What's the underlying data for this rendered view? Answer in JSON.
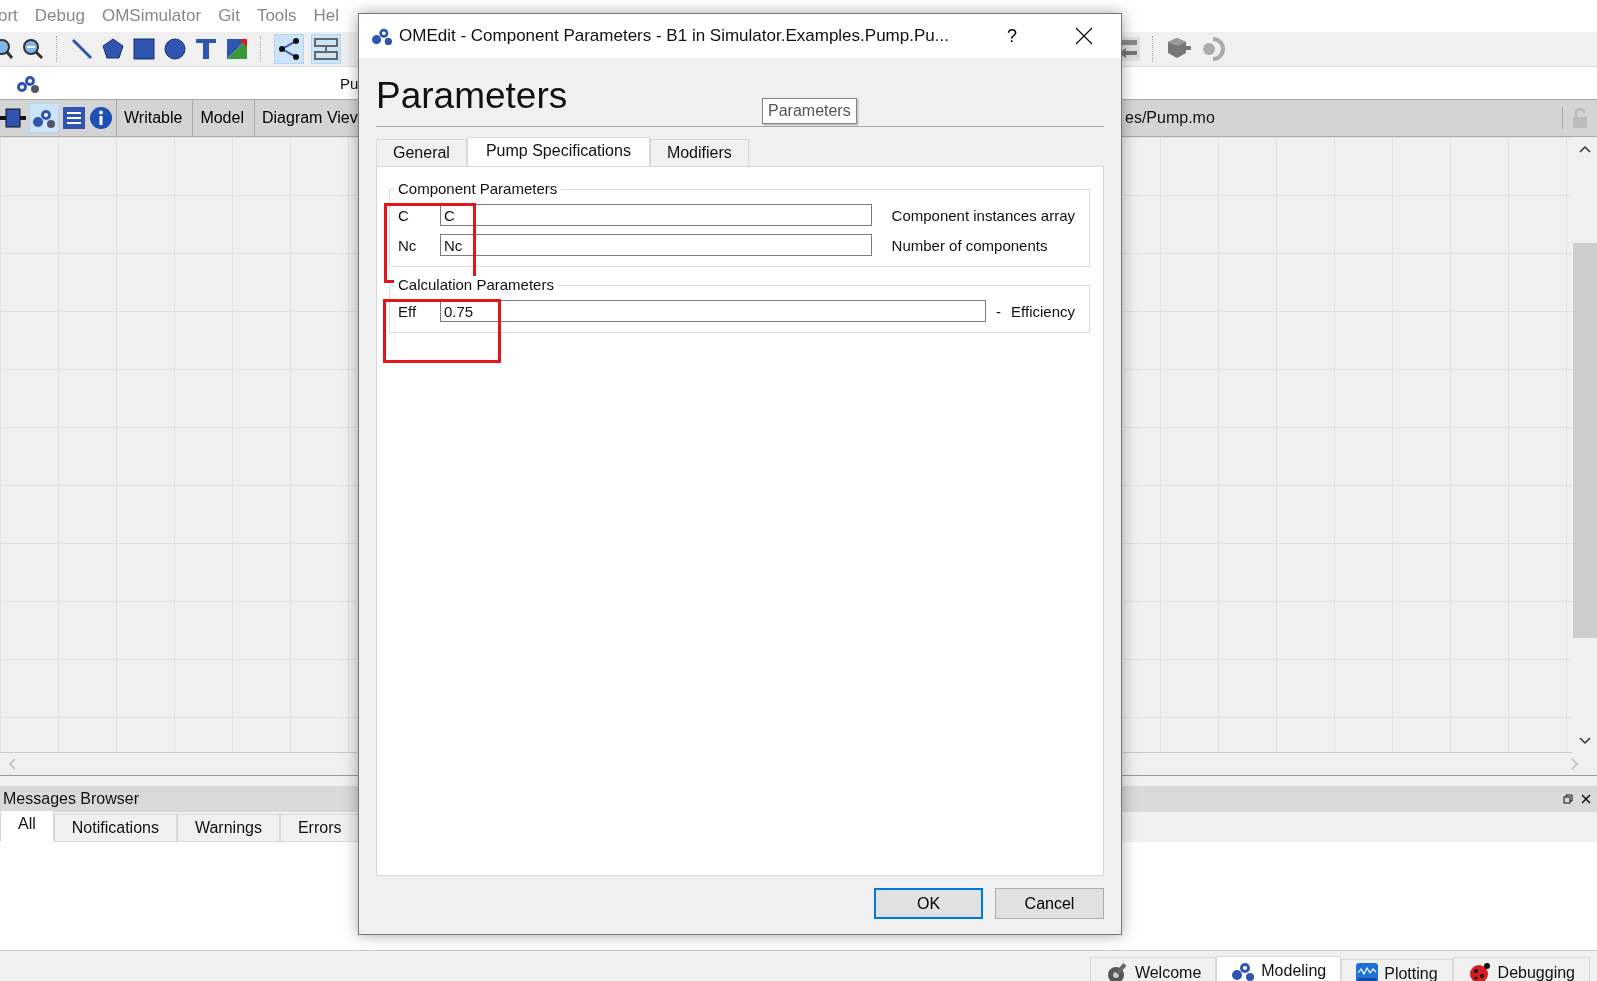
{
  "menu_bar": {
    "items": [
      "ort",
      "Debug",
      "OMSimulator",
      "Git",
      "Tools",
      "Hel"
    ]
  },
  "model_header": {
    "label": "Pu"
  },
  "model_bar": {
    "buttons": [
      "Writable",
      "Model",
      "Diagram Viev"
    ],
    "path": "es/Pump.mo"
  },
  "messages_browser": {
    "title": "Messages Browser",
    "tabs": [
      {
        "label": "All",
        "selected": true
      },
      {
        "label": "Notifications",
        "selected": false
      },
      {
        "label": "Warnings",
        "selected": false
      },
      {
        "label": "Errors",
        "selected": false
      }
    ]
  },
  "perspectives": [
    {
      "label": "Welcome",
      "selected": false
    },
    {
      "label": "Modeling",
      "selected": true
    },
    {
      "label": "Plotting",
      "selected": false
    },
    {
      "label": "Debugging",
      "selected": false
    }
  ],
  "dialog": {
    "title": "OMEdit - Component Parameters - B1 in Simulator.Examples.Pump.Pu...",
    "help": "?",
    "heading": "Parameters",
    "tooltip": "Parameters",
    "tabs": [
      {
        "label": "General",
        "selected": false
      },
      {
        "label": "Pump Specifications",
        "selected": true
      },
      {
        "label": "Modifiers",
        "selected": false
      }
    ],
    "groups": [
      {
        "title": "Component Parameters",
        "highlighted": true,
        "params": [
          {
            "name": "C",
            "value": "C",
            "description": "Component instances array"
          },
          {
            "name": "Nc",
            "value": "Nc",
            "description": "Number of components"
          }
        ]
      },
      {
        "title": "Calculation Parameters",
        "highlighted": true,
        "params": [
          {
            "name": "Eff",
            "value": "0.75",
            "unit": "-",
            "description": "Efficiency"
          }
        ]
      }
    ],
    "buttons": [
      "OK",
      "Cancel"
    ]
  }
}
